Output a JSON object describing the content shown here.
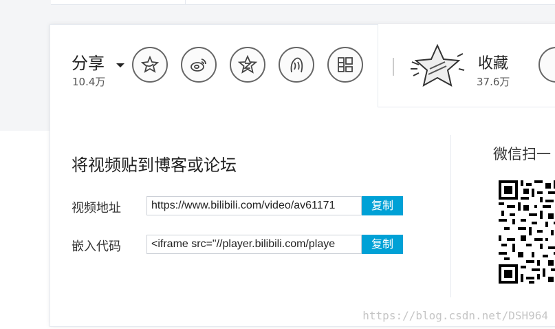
{
  "share": {
    "title": "分享",
    "count": "10.4万",
    "icons": [
      "qzone-star-icon",
      "weibo-icon",
      "qq-zone-icon",
      "tieba-icon",
      "douban-icon"
    ]
  },
  "favorite": {
    "label": "收藏",
    "count": "37.6万",
    "icon": "star-favorite-icon"
  },
  "embed": {
    "title": "将视频贴到博客或论坛",
    "video_url_label": "视频地址",
    "video_url_value": "https://www.bilibili.com/video/av61171",
    "embed_code_label": "嵌入代码",
    "embed_code_value": "<iframe src=\"//player.bilibili.com/playe",
    "copy_label": "复制"
  },
  "wechat": {
    "title": "微信扫一"
  },
  "watermark": "https://blog.csdn.net/DSH964",
  "colors": {
    "accent": "#00a1d6",
    "panel_border": "#e5e9ef",
    "background": "#f4f5f7"
  }
}
